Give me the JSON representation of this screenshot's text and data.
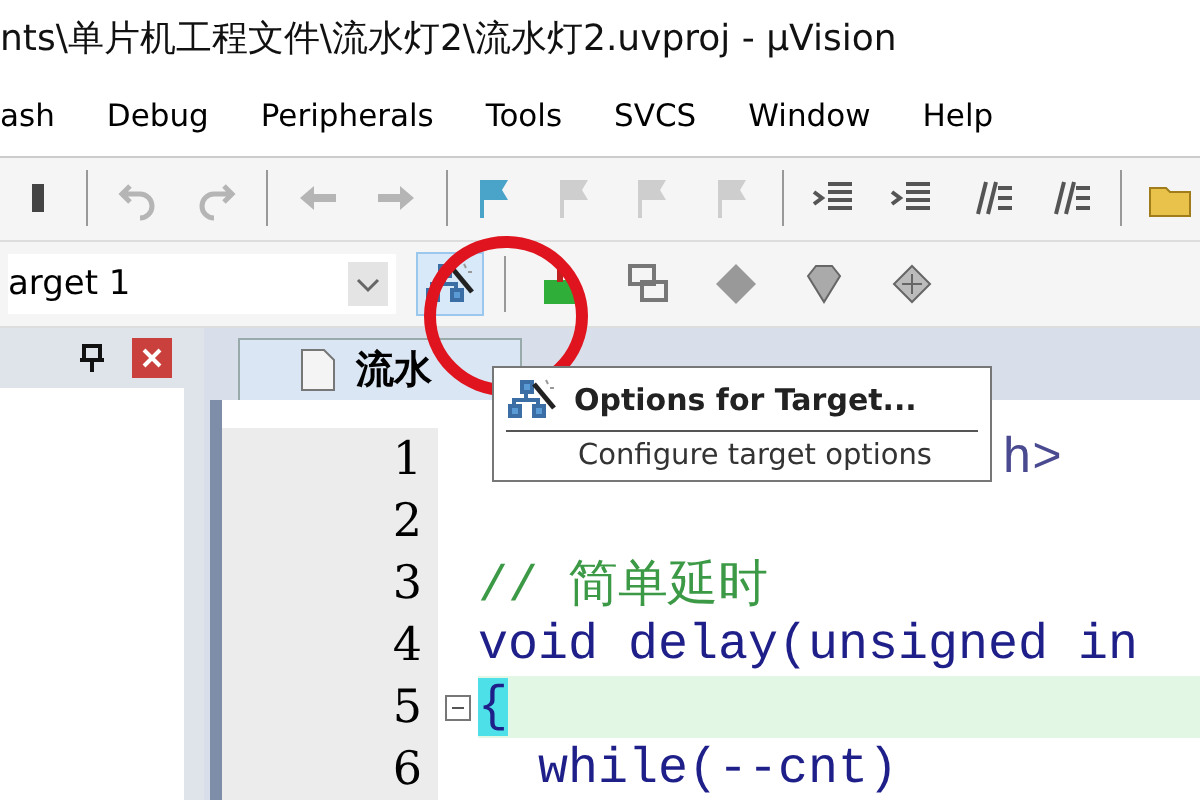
{
  "window": {
    "title": "nts\\单片机工程文件\\流水灯2\\流水灯2.uvproj - µVision"
  },
  "menu": [
    "ash",
    "Debug",
    "Peripherals",
    "Tools",
    "SVCS",
    "Window",
    "Help"
  ],
  "toolbar": [
    {
      "disabled": false
    },
    {
      "disabled": true
    },
    {
      "disabled": true
    },
    {
      "disabled": true
    },
    {
      "disabled": true
    },
    {
      "disabled": false
    },
    {
      "disabled": true
    },
    {
      "disabled": true
    },
    {
      "disabled": true
    },
    {
      "disabled": false
    },
    {
      "disabled": false
    },
    {
      "disabled": false
    },
    {
      "disabled": false
    },
    {
      "disabled": false
    }
  ],
  "build_toolbar": {
    "target": "arget 1",
    "buttons": [
      {
        "selected": true
      },
      {
        "selected": false
      },
      {
        "selected": false
      },
      {
        "selected": false
      },
      {
        "selected": false
      },
      {
        "selected": false
      }
    ]
  },
  "editor": {
    "tab": "流水",
    "lines": [
      {
        "number": "1",
        "code": "h>",
        "kind": "covered",
        "current": false
      },
      {
        "number": "2",
        "current": false
      },
      {
        "number": "3",
        "code": "// 简单延时",
        "kind": "comment",
        "current": false
      },
      {
        "number": "4",
        "code": "void delay(unsigned in",
        "kind": "code",
        "current": false
      },
      {
        "number": "5",
        "code": "{",
        "kind": "code",
        "current": true
      },
      {
        "number": "6",
        "code": "while(--cnt)",
        "kind": "code",
        "current": false
      }
    ]
  },
  "tooltip": {
    "title": "Options for Target...",
    "description": "Configure target options"
  }
}
